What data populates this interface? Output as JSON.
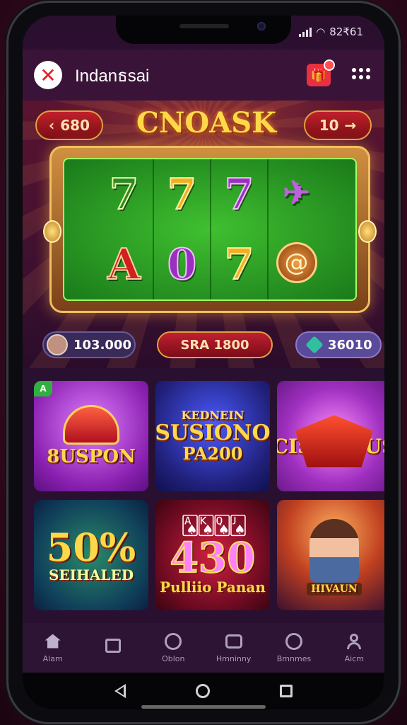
{
  "status_bar": {
    "time": "82₹61"
  },
  "app": {
    "title": "Indanธsai",
    "logo_glyph": "✕"
  },
  "hero": {
    "game_title": "CNOASK",
    "nav_left_label": "680",
    "nav_right_label": "10",
    "reels": [
      [
        "7",
        "A"
      ],
      [
        "7",
        "0"
      ],
      [
        "7",
        "7"
      ],
      [
        "bird",
        "swirl"
      ]
    ],
    "stats": {
      "balance": "103.000",
      "spin_label": "SRA 1800",
      "coins": "36010"
    }
  },
  "games": [
    {
      "title": "8USPON",
      "badge": "A"
    },
    {
      "title_top": "KEDNEIN",
      "title": "SUSIONO",
      "title_bottom": "PA200"
    },
    {
      "title": "CISHAHUS"
    },
    {
      "title": "50%",
      "subtitle": "SEIHALED"
    },
    {
      "title": "430",
      "subtitle": "Pulliio Panan"
    },
    {
      "banner": "HIVAUN"
    }
  ],
  "bottom_nav": [
    {
      "label": "Alam",
      "icon": "home-icon"
    },
    {
      "label": "",
      "icon": "gift-box-icon"
    },
    {
      "label": "Oblon",
      "icon": "wheel-icon"
    },
    {
      "label": "Hmninny",
      "icon": "tv-icon"
    },
    {
      "label": "Bmnmes",
      "icon": "clock-icon"
    },
    {
      "label": "Aicm",
      "icon": "user-icon"
    }
  ],
  "colors": {
    "accent_gold": "#ffd84a",
    "accent_red": "#c0202a",
    "reel_green": "#40c030",
    "app_bar": "#3a1438"
  }
}
